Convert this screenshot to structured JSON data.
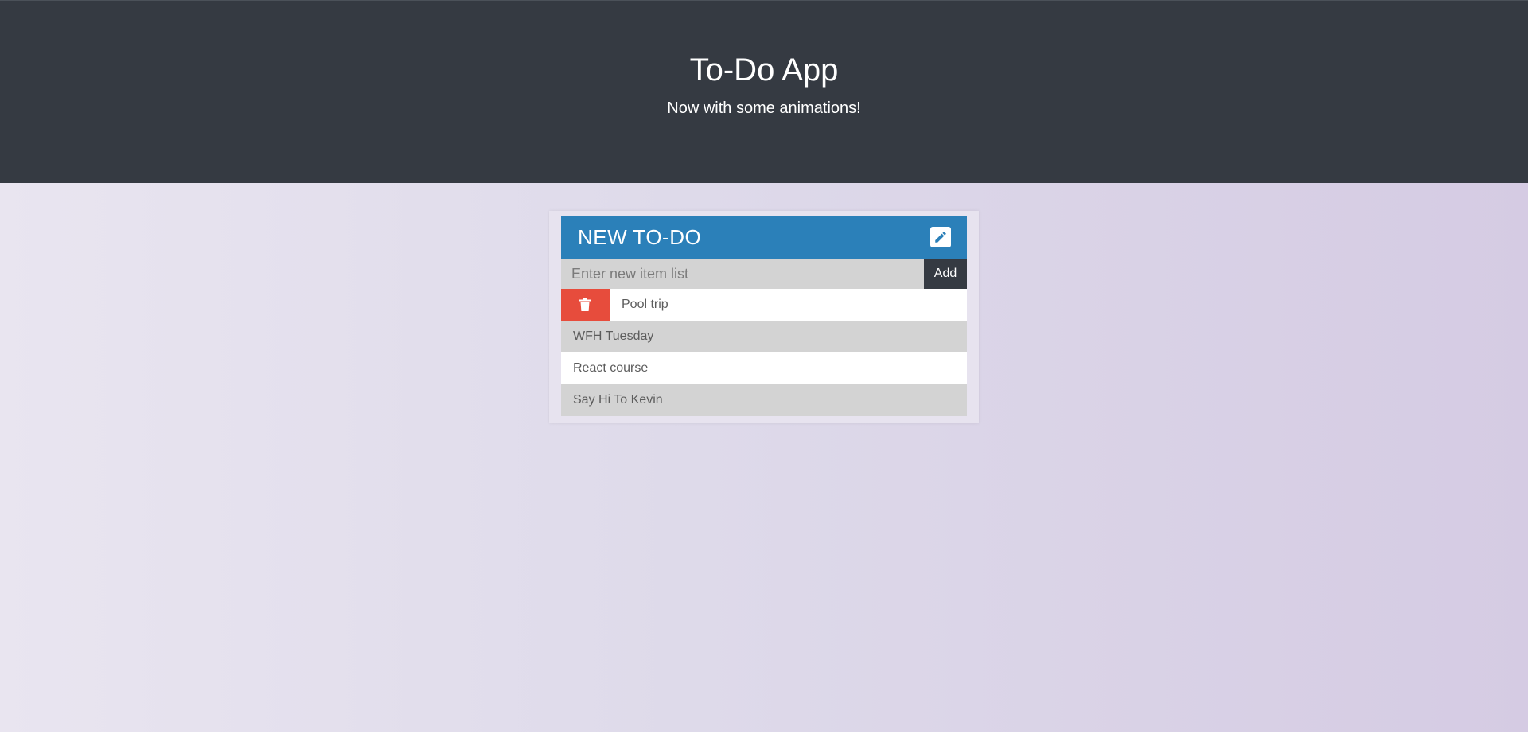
{
  "header": {
    "title": "To-Do App",
    "subtitle": "Now with some animations!",
    "background_color": "#353a42"
  },
  "card": {
    "title": "NEW TO-DO",
    "header_color": "#2b80b9",
    "edit_icon": "pencil-icon",
    "input": {
      "value": "",
      "placeholder": "Enter new item list"
    },
    "add_label": "Add",
    "delete_icon": "trash-icon",
    "delete_color": "#e74c3c",
    "items": [
      {
        "label": "Pool trip"
      },
      {
        "label": "WFH Tuesday"
      },
      {
        "label": "React course"
      },
      {
        "label": "Say Hi To Kevin"
      }
    ]
  }
}
